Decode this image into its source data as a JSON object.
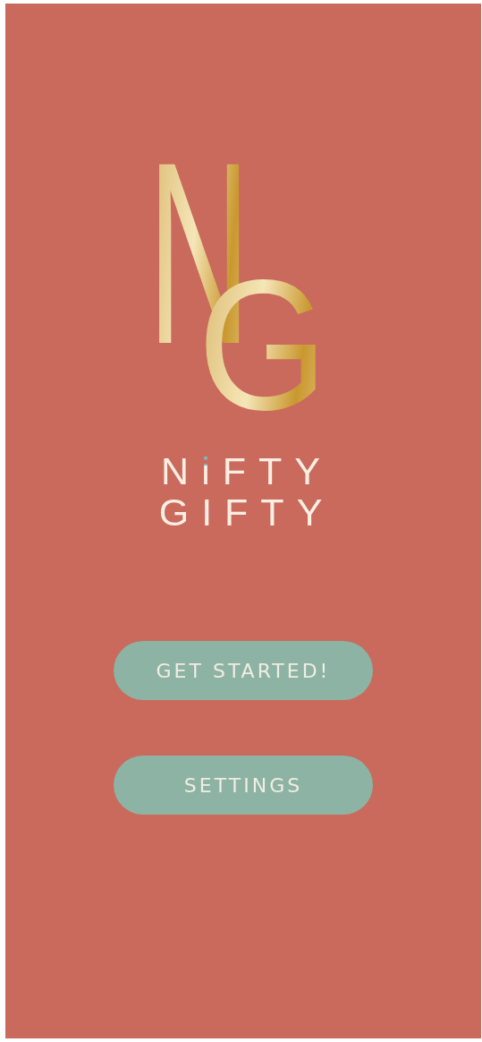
{
  "logo": {
    "letters": [
      "N",
      "G"
    ]
  },
  "wordmark": {
    "lines": [
      "NiFTY",
      "GIFTY"
    ]
  },
  "buttons": [
    {
      "label": "GET STARTED!"
    },
    {
      "label": "SETTINGS"
    }
  ]
}
